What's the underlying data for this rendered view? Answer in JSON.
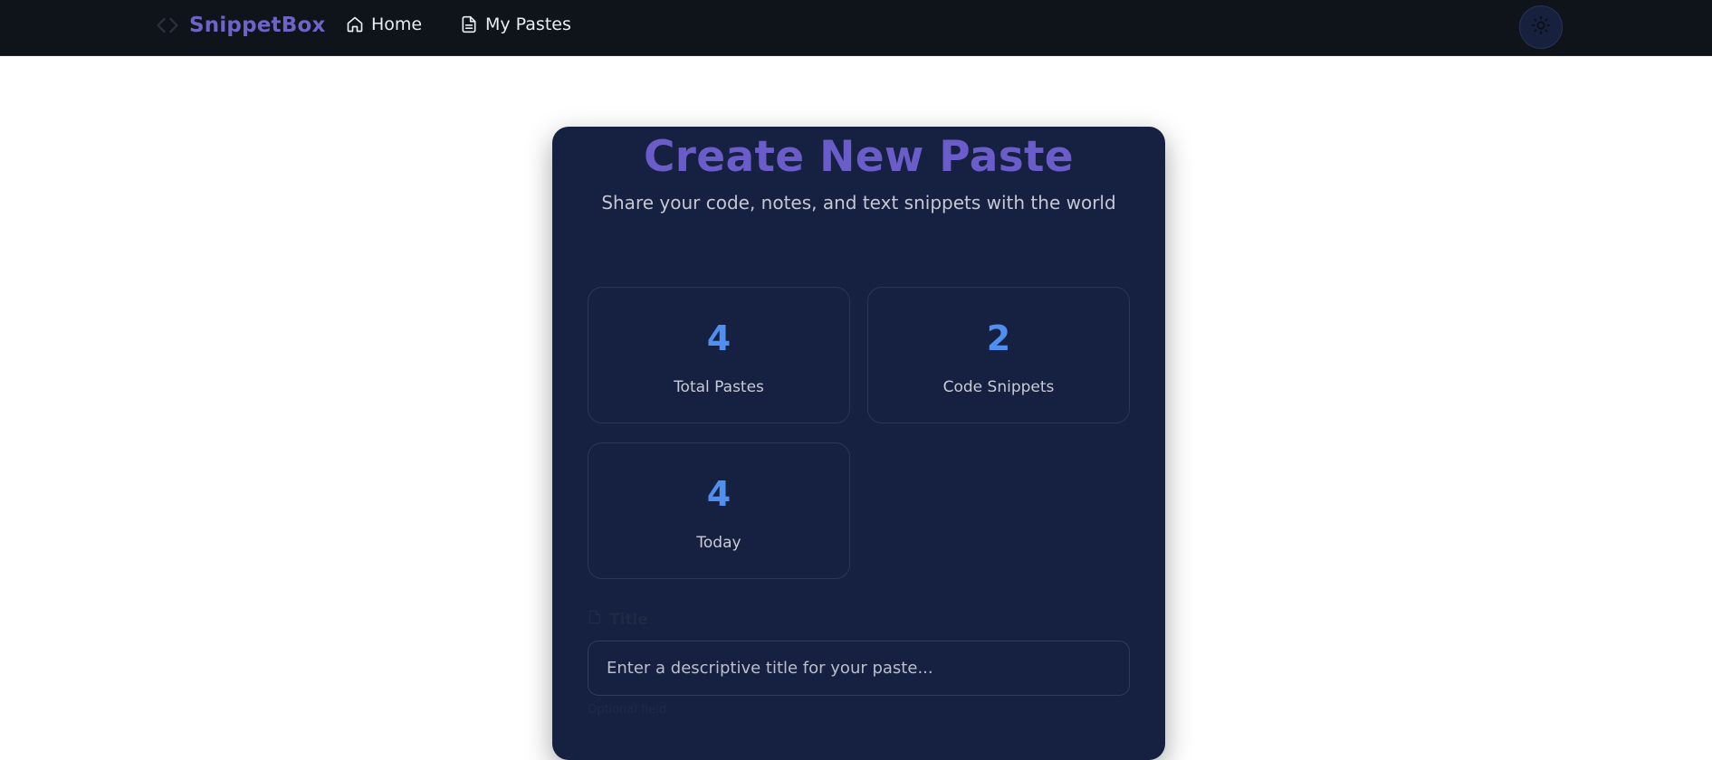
{
  "nav": {
    "brand": "SnippetBox",
    "links": [
      {
        "label": "Home",
        "icon": "home-icon"
      },
      {
        "label": "My Pastes",
        "icon": "document-icon"
      }
    ],
    "theme_toggle_icon": "sun-icon"
  },
  "hero": {
    "title": "Create New Paste",
    "subtitle": "Share your code, notes, and text snippets with the world"
  },
  "stats": [
    {
      "value": "4",
      "label": "Total Pastes"
    },
    {
      "value": "2",
      "label": "Code Snippets"
    },
    {
      "value": "4",
      "label": "Today"
    }
  ],
  "form": {
    "title_label": "Title",
    "title_placeholder": "Enter a descriptive title for your paste...",
    "title_helper": "Optional field"
  },
  "colors": {
    "brand": "#6e63c9",
    "accent": "#4f8ff0",
    "card_bg": "#162040",
    "nav_bg": "#0f141a"
  }
}
